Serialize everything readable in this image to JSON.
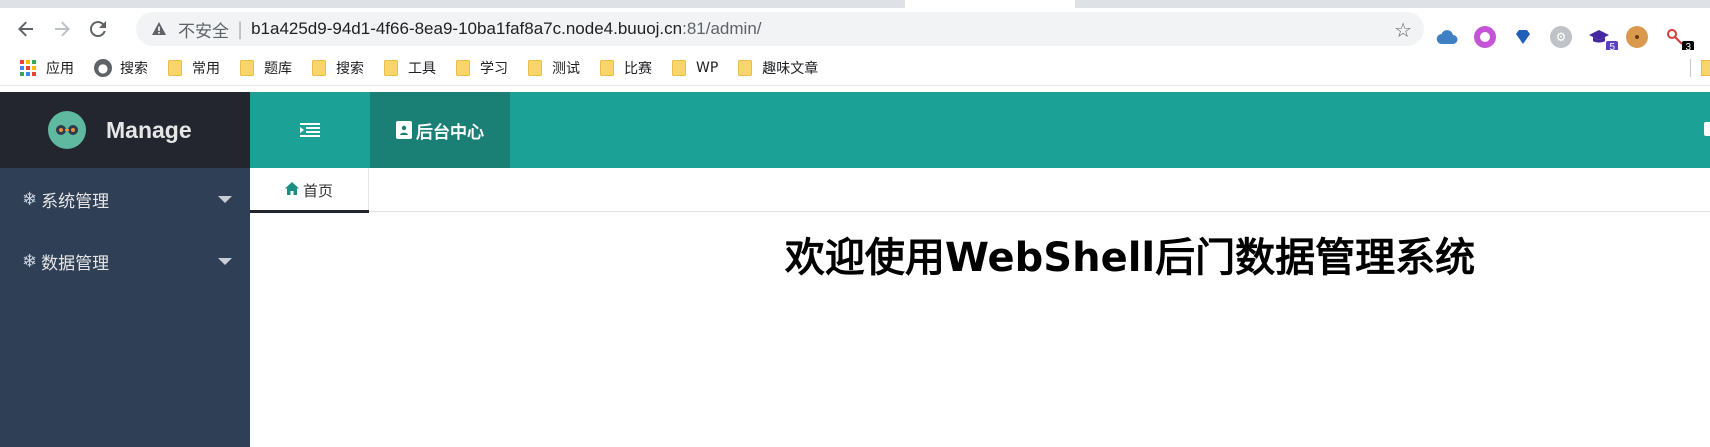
{
  "browser": {
    "insecure_label": "不安全",
    "url_main": "b1a425d9-94d1-4f66-8ea9-10ba1faf8a7c.node4.buuoj.cn",
    "url_port": ":81/admin/",
    "extensions": [
      {
        "name": "cloud-extension-icon",
        "badge": ""
      },
      {
        "name": "ring-extension-icon",
        "badge": ""
      },
      {
        "name": "heart-extension-icon",
        "badge": ""
      },
      {
        "name": "gear-extension-icon",
        "badge": ""
      },
      {
        "name": "hat-extension-icon",
        "badge": "5"
      },
      {
        "name": "cookie-extension-icon",
        "badge": ""
      },
      {
        "name": "key-extension-icon",
        "badge": "3"
      }
    ]
  },
  "bookmarks": {
    "apps_label": "应用",
    "search_label": "搜索",
    "folders": [
      "常用",
      "题库",
      "搜索",
      "工具",
      "学习",
      "测试",
      "比赛",
      "WP",
      "趣味文章"
    ]
  },
  "sidebar": {
    "logo_text": "Manage",
    "items": [
      {
        "label": "系统管理"
      },
      {
        "label": "数据管理"
      }
    ]
  },
  "header": {
    "tab_label": "后台中心"
  },
  "tabs": {
    "home_label": "首页"
  },
  "content": {
    "welcome": "欢迎使用WebShell后门数据管理系统"
  },
  "colors": {
    "header_bg": "#1ba195",
    "header_active": "#1a7f75",
    "sidebar_bg": "#2f4056",
    "logo_bg": "#23262e"
  }
}
